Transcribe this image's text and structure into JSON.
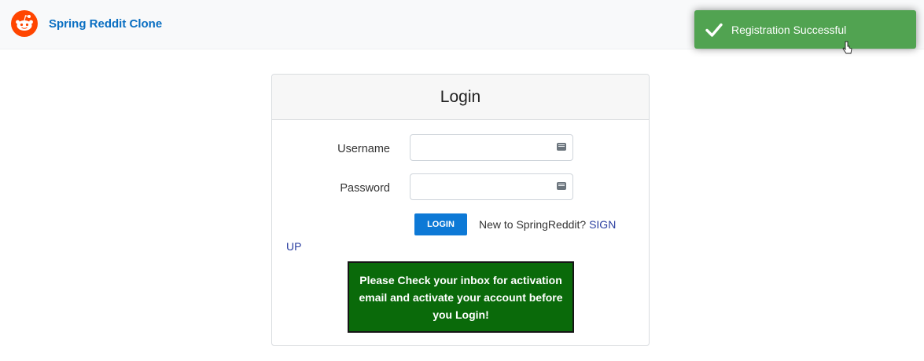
{
  "navbar": {
    "logo_icon": "reddit-logo-icon",
    "brand_text": "Spring Reddit Clone",
    "brand_color": "#0a6fc2"
  },
  "toast": {
    "icon": "checkmark-icon",
    "message": "Registration Successful",
    "color": "#51a351"
  },
  "login_card": {
    "title": "Login",
    "username_label": "Username",
    "username_value": "",
    "password_label": "Password",
    "password_value": "",
    "login_button": "LOGIN",
    "signup_prompt": "New to SpringReddit?",
    "signup_link_part1": "SIGN",
    "signup_link_part2": "UP",
    "activation_message": "Please Check your inbox for activation email and activate your account before you Login!"
  },
  "colors": {
    "primary": "#0d79d6",
    "activation_bg": "#0a6a0a",
    "link": "#2a3ea0"
  }
}
